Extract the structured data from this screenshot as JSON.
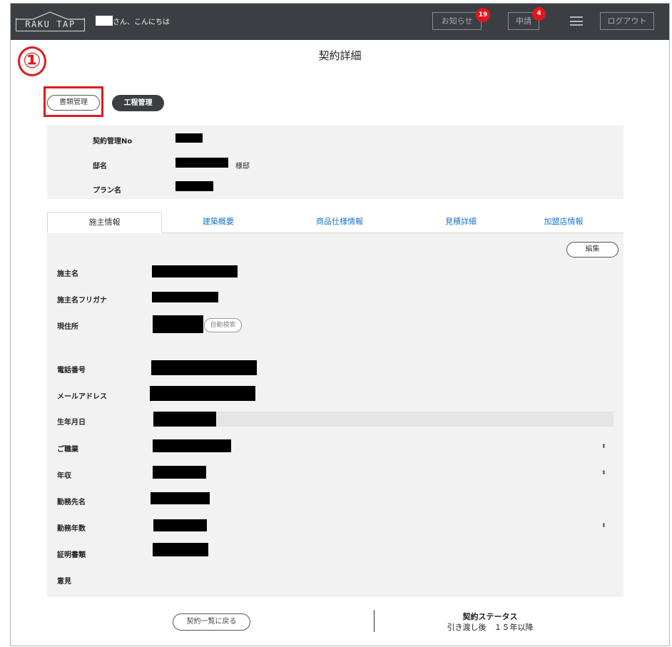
{
  "header": {
    "logo_text": "RAKU TAP",
    "greeting": "さん、こんにちは",
    "notice_label": "お知らせ",
    "notice_count": "19",
    "request_label": "申請",
    "request_count": "4",
    "logout_label": "ログアウト"
  },
  "page": {
    "title": "契約詳細"
  },
  "annotation": {
    "marker": "①"
  },
  "action_buttons": {
    "documents": "書類管理",
    "process": "工程管理"
  },
  "summary": {
    "contract_no_label": "契約管理No",
    "residence_label": "邸名",
    "residence_suffix": "様邸",
    "plan_label": "プラン名"
  },
  "tabs": [
    {
      "label": "施主情報",
      "active": true
    },
    {
      "label": "建築概要",
      "active": false
    },
    {
      "label": "商品仕様情報",
      "active": false
    },
    {
      "label": "見積詳細",
      "active": false
    },
    {
      "label": "加盟店情報",
      "active": false
    }
  ],
  "detail": {
    "edit_label": "編集",
    "auto_search_label": "自動検索",
    "fields": [
      {
        "label": "施主名"
      },
      {
        "label": "施主名フリガナ"
      },
      {
        "label": "現住所"
      },
      {
        "label": "電話番号"
      },
      {
        "label": "メールアドレス"
      },
      {
        "label": "生年月日"
      },
      {
        "label": "ご職業"
      },
      {
        "label": "年収"
      },
      {
        "label": "勤務先名"
      },
      {
        "label": "勤務年数"
      },
      {
        "label": "証明書類"
      },
      {
        "label": "意見"
      }
    ]
  },
  "footer": {
    "back_label": "契約一覧に戻る",
    "status_title": "契約ステータス",
    "status_value": "引き渡し後　１５年以降"
  },
  "colors": {
    "header_bg": "#3b3e43",
    "badge": "#e4161d",
    "annotation": "#e01b1b",
    "link": "#1a73c8",
    "panel_bg": "#f2f2f2"
  }
}
